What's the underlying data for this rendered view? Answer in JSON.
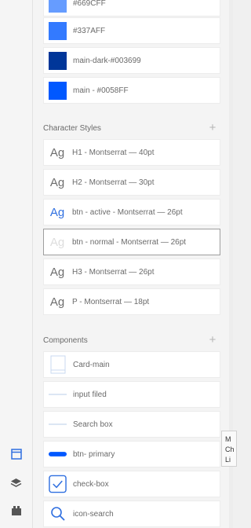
{
  "colors": [
    {
      "label": "#669CFF",
      "hex": "#669cff"
    },
    {
      "label": "#337AFF",
      "hex": "#337aff"
    },
    {
      "label": "main-dark-#003699",
      "hex": "#003699"
    },
    {
      "label": "main - #0058FF",
      "hex": "#0058ff"
    }
  ],
  "character_styles": {
    "title": "Character Styles",
    "add_icon": "+",
    "items": [
      {
        "glyph": "Ag",
        "label": "H1 - Montserrat — 40pt"
      },
      {
        "glyph": "Ag",
        "label": "H2 - Montserrat — 30pt"
      },
      {
        "glyph": "Ag",
        "label": "btn - active - Montserrat — 26pt",
        "color": "#2f6fe0"
      },
      {
        "glyph": "Ag",
        "label": "btn - normal - Montserrat — 26pt"
      },
      {
        "glyph": "Ag",
        "label": "H3 - Montserrat — 26pt"
      },
      {
        "glyph": "Ag",
        "label": "P - Montserrat — 18pt"
      }
    ]
  },
  "components": {
    "title": "Components",
    "add_icon": "+",
    "items": [
      {
        "label": "Card-main",
        "icon": "card-thumbnail"
      },
      {
        "label": "input filed",
        "icon": "input-thumbnail"
      },
      {
        "label": "Search box",
        "icon": "search-box-thumbnail"
      },
      {
        "label": "btn- primary",
        "icon": "button-thumbnail",
        "accent": "#0058ff"
      },
      {
        "label": "check-box",
        "icon": "checkbox-thumbnail",
        "accent": "#2f6fe0"
      },
      {
        "label": "icon-search",
        "icon": "search-icon"
      }
    ]
  },
  "rail_icons": [
    "document-icon",
    "layers-icon",
    "plugins-icon"
  ],
  "tooltip": {
    "lines": [
      "M",
      "Ch",
      "Li"
    ]
  },
  "accent": "#2f6fe0"
}
